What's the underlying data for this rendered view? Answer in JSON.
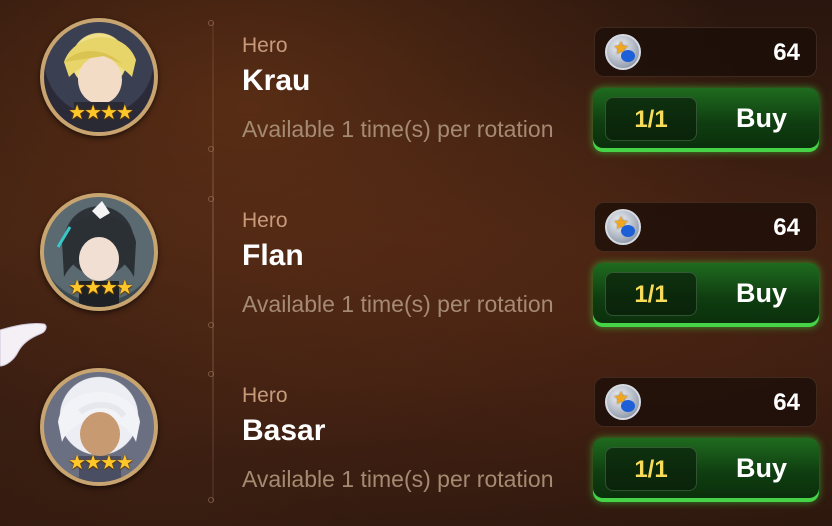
{
  "items": [
    {
      "type": "Hero",
      "name": "Krau",
      "availability": "Available 1 time(s) per rotation",
      "price": "64",
      "quantity": "1/1",
      "buy_label": "Buy"
    },
    {
      "type": "Hero",
      "name": "Flan",
      "availability": "Available 1 time(s) per rotation",
      "price": "64",
      "quantity": "1/1",
      "buy_label": "Buy"
    },
    {
      "type": "Hero",
      "name": "Basar",
      "availability": "Available 1 time(s) per rotation",
      "price": "64",
      "quantity": "1/1",
      "buy_label": "Buy"
    }
  ],
  "stars": "★★★★",
  "currency_icon": "coin-icon",
  "colors": {
    "buy_button": "#1f6b1f",
    "quantity_text": "#f6dc5a",
    "star": "#ffc72a"
  }
}
